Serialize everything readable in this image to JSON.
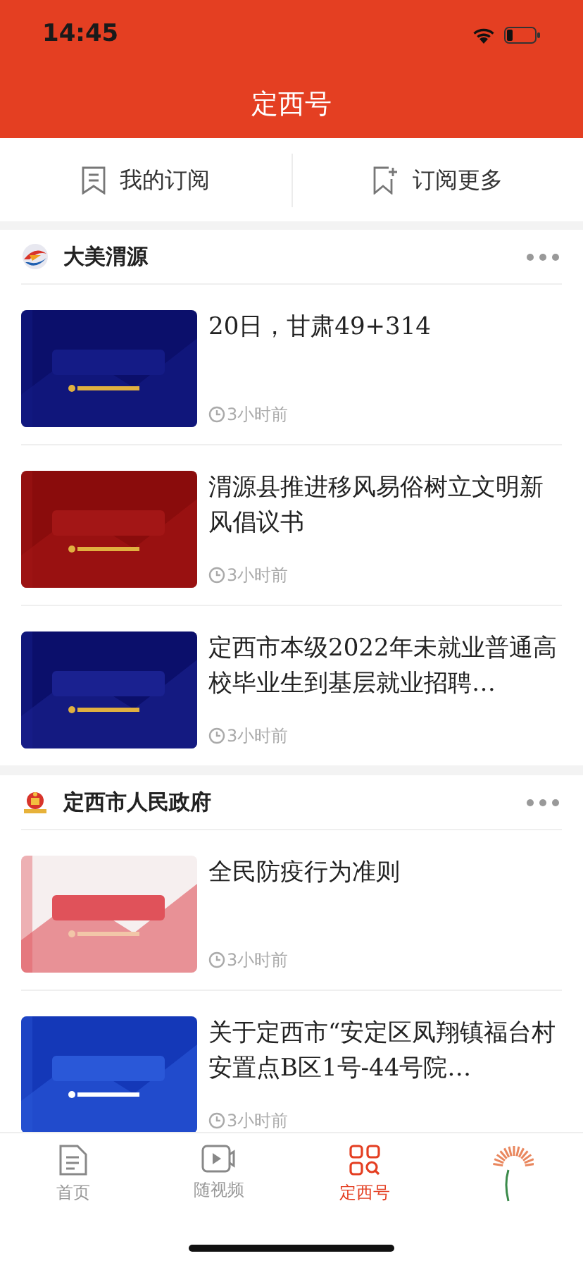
{
  "status_bar": {
    "time": "14:45"
  },
  "header": {
    "title": "定西号"
  },
  "subscribe_bar": [
    {
      "kind": "mine",
      "label": "我的订阅"
    },
    {
      "kind": "more",
      "label": "订阅更多"
    }
  ],
  "sections": [
    {
      "name": "大美渭源",
      "kind": "swirl",
      "items": [
        {
          "title": "20日，甘肃49+314",
          "time": "3小时前"
        },
        {
          "title": "渭源县推进移风易俗树立文明新风倡议书",
          "time": "3小时前"
        },
        {
          "title": "定西市本级2022年未就业普通高校毕业生到基层就业招聘…",
          "time": "3小时前"
        }
      ]
    },
    {
      "name": "定西市人民政府",
      "kind": "emblem",
      "items": [
        {
          "title": "全民防疫行为准则",
          "time": "3小时前"
        },
        {
          "title": "关于定西市“安定区凤翔镇福台村安置点B区1号-44号院…",
          "time": "3小时前"
        }
      ]
    }
  ],
  "tab_bar": [
    {
      "kind": "doc",
      "label": "首页",
      "selected": false
    },
    {
      "kind": "video",
      "label": "随视频",
      "selected": false
    },
    {
      "kind": "grid",
      "label": "定西号",
      "selected": true
    },
    {
      "kind": "logo",
      "selected": false
    }
  ]
}
